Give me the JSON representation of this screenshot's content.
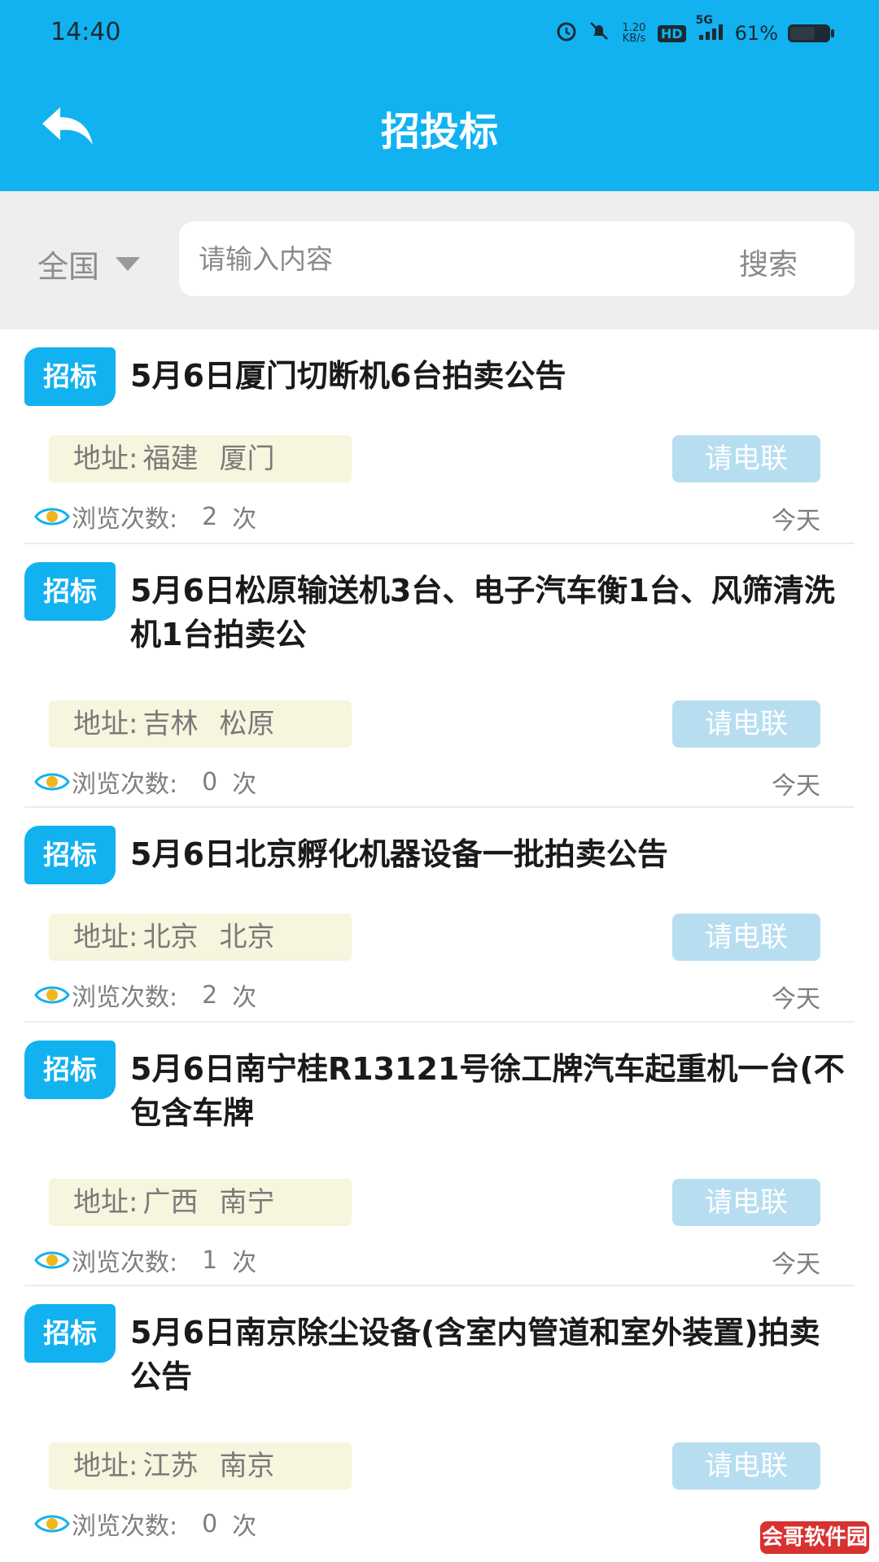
{
  "status": {
    "time": "14:40",
    "net_speed": "1.20 KB/s",
    "hd": "HD",
    "signal": "5G",
    "battery": "61%"
  },
  "header": {
    "title": "招投标"
  },
  "search": {
    "region": "全国",
    "placeholder": "请输入内容",
    "button": "搜索"
  },
  "list": {
    "items": [
      {
        "tag": "招标",
        "title": "5月6日厦门切断机6台拍卖公告",
        "addr_label": "地址:",
        "province": "福建",
        "city": "厦门",
        "call": "请电联",
        "views_label": "浏览次数:",
        "views": "2",
        "views_unit": "次",
        "date": "今天"
      },
      {
        "tag": "招标",
        "title": "5月6日松原输送机3台、电子汽车衡1台、风筛清洗机1台拍卖公",
        "addr_label": "地址:",
        "province": "吉林",
        "city": "松原",
        "call": "请电联",
        "views_label": "浏览次数:",
        "views": "0",
        "views_unit": "次",
        "date": "今天"
      },
      {
        "tag": "招标",
        "title": "5月6日北京孵化机器设备一批拍卖公告",
        "addr_label": "地址:",
        "province": "北京",
        "city": "北京",
        "call": "请电联",
        "views_label": "浏览次数:",
        "views": "2",
        "views_unit": "次",
        "date": "今天"
      },
      {
        "tag": "招标",
        "title": "5月6日南宁桂R13121号徐工牌汽车起重机一台(不包含车牌",
        "addr_label": "地址:",
        "province": "广西",
        "city": "南宁",
        "call": "请电联",
        "views_label": "浏览次数:",
        "views": "1",
        "views_unit": "次",
        "date": "今天"
      },
      {
        "tag": "招标",
        "title": "5月6日南京除尘设备(含室内管道和室外装置)拍卖公告",
        "addr_label": "地址:",
        "province": "江苏",
        "city": "南京",
        "call": "请电联",
        "views_label": "浏览次数:",
        "views": "0",
        "views_unit": "次",
        "date": ""
      }
    ]
  },
  "watermark": "会哥软件园",
  "colors": {
    "brand": "#12b2f0",
    "address_bg": "#f6f5dd",
    "call_bg": "#b7def0"
  }
}
